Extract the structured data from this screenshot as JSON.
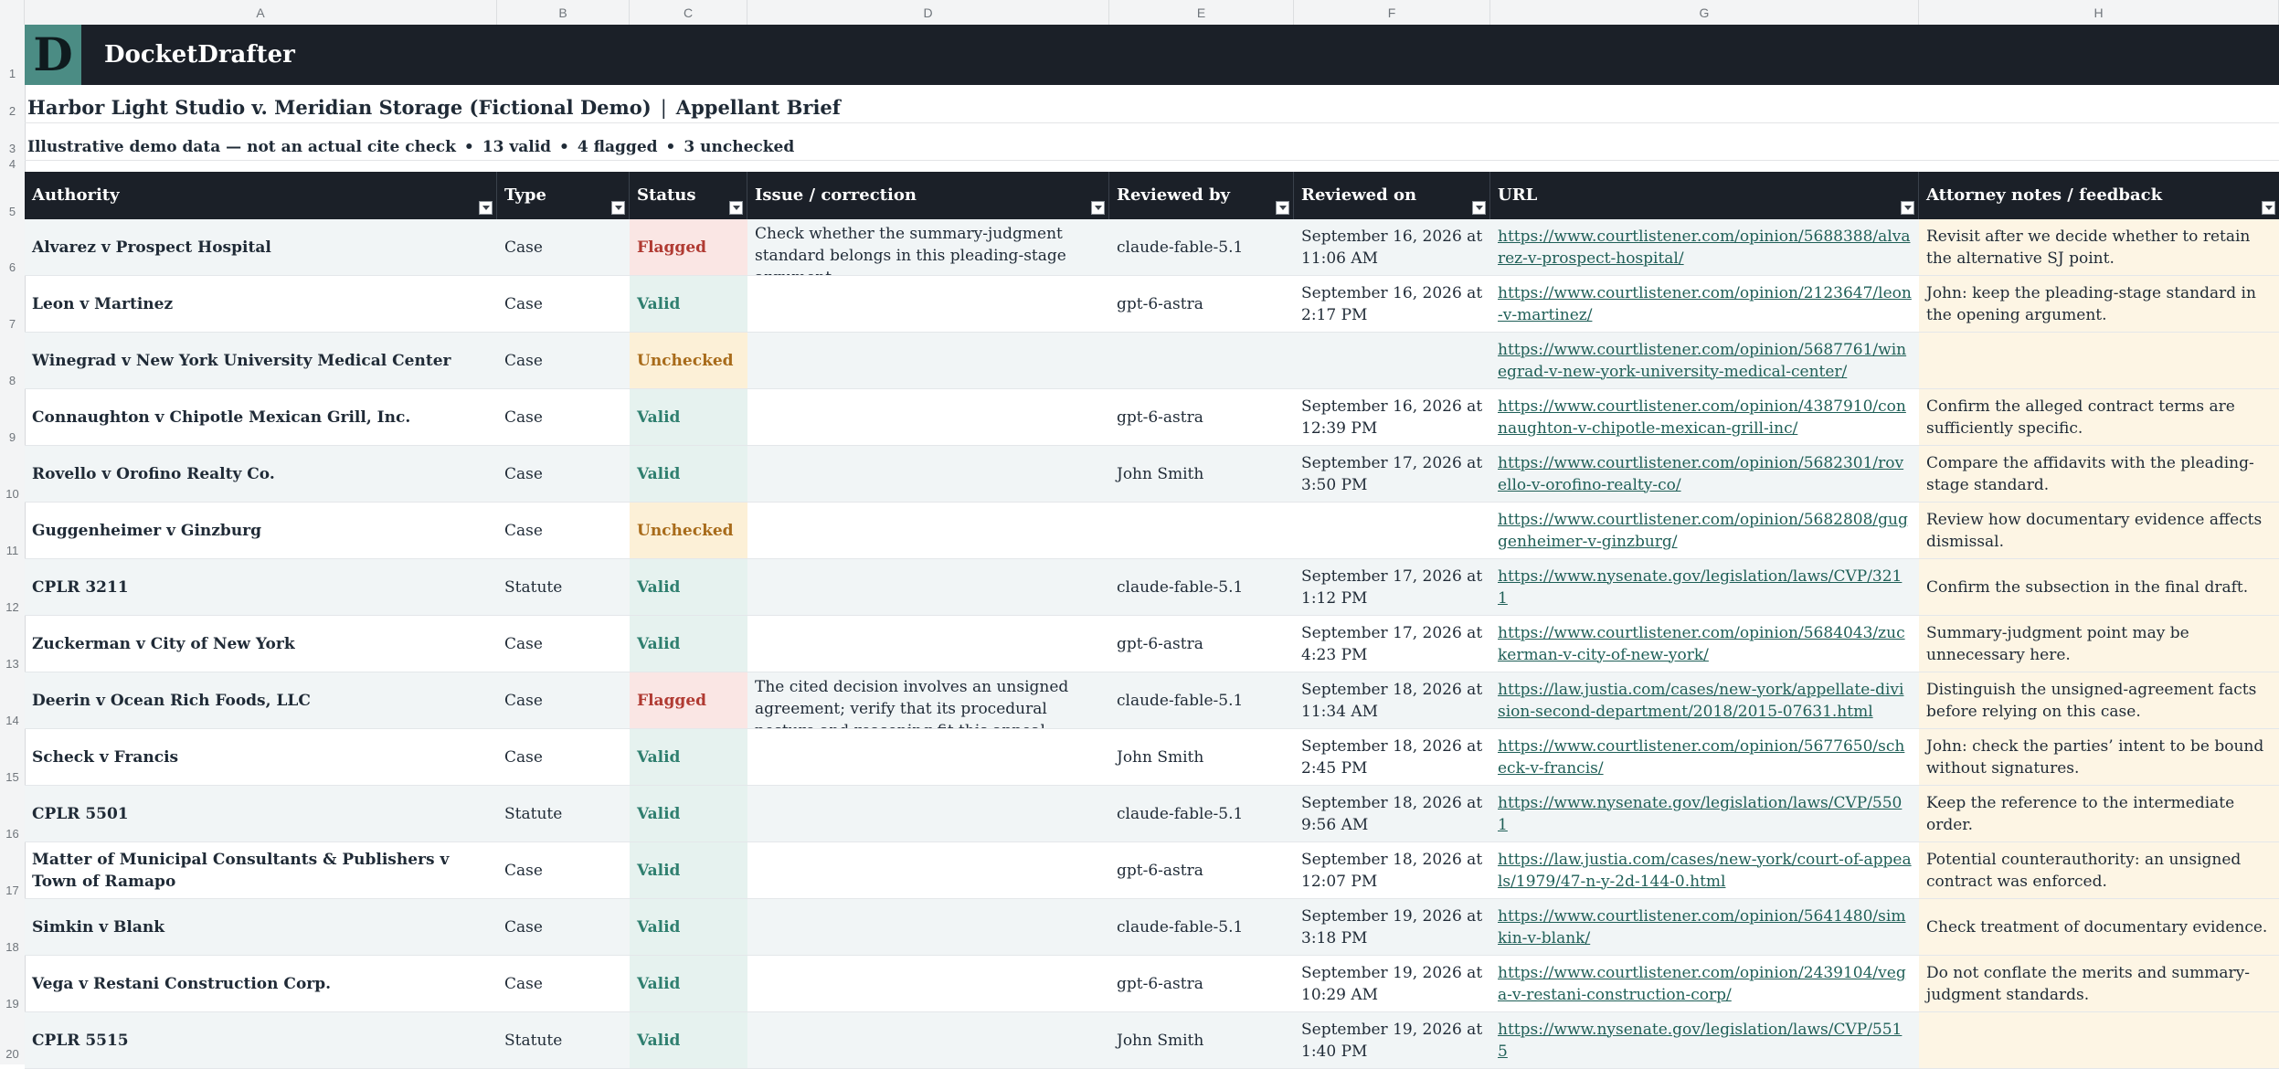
{
  "columns_letters": [
    "A",
    "B",
    "C",
    "D",
    "E",
    "F",
    "G",
    "H"
  ],
  "brand": {
    "logo_letter": "D",
    "name": "DocketDrafter"
  },
  "title": {
    "case": "Harbor Light Studio v. Meridian Storage (Fictional Demo)",
    "separator": "|",
    "document": "Appellant Brief"
  },
  "subtitle": {
    "note": "Illustrative demo data — not an actual cite check",
    "valid": "13 valid",
    "flagged": "4 flagged",
    "unchecked": "3 unchecked",
    "dot": "•"
  },
  "table": {
    "headers": [
      "Authority",
      "Type",
      "Status",
      "Issue / correction",
      "Reviewed by",
      "Reviewed on",
      "URL",
      "Attorney notes / feedback"
    ],
    "rows": [
      {
        "authority": "Alvarez v Prospect Hospital",
        "type": "Case",
        "status": "Flagged",
        "status_class": "flagged",
        "issue": "Check whether the summary-judgment standard belongs in this pleading-stage argument.",
        "reviewer": "claude-fable-5.1",
        "date": "September 16, 2026 at 11:06 AM",
        "url": "https://www.courtlistener.com/opinion/5688388/alvarez-v-prospect-hospital/",
        "notes": "Revisit after we decide whether to retain the alternative SJ point."
      },
      {
        "authority": "Leon v Martinez",
        "type": "Case",
        "status": "Valid",
        "status_class": "valid",
        "issue": "",
        "reviewer": "gpt-6-astra",
        "date": "September 16, 2026 at 2:17 PM",
        "url": "https://www.courtlistener.com/opinion/2123647/leon-v-martinez/",
        "notes": "John: keep the pleading-stage standard in the opening argument."
      },
      {
        "authority": "Winegrad v New York University Medical Center",
        "type": "Case",
        "status": "Unchecked",
        "status_class": "unchecked",
        "issue": "",
        "reviewer": "",
        "date": "",
        "url": "https://www.courtlistener.com/opinion/5687761/winegrad-v-new-york-university-medical-center/",
        "notes": ""
      },
      {
        "authority": "Connaughton v Chipotle Mexican Grill, Inc.",
        "type": "Case",
        "status": "Valid",
        "status_class": "valid",
        "issue": "",
        "reviewer": "gpt-6-astra",
        "date": "September 16, 2026 at 12:39 PM",
        "url": "https://www.courtlistener.com/opinion/4387910/connaughton-v-chipotle-mexican-grill-inc/",
        "notes": "Confirm the alleged contract terms are sufficiently specific."
      },
      {
        "authority": "Rovello v Orofino Realty Co.",
        "type": "Case",
        "status": "Valid",
        "status_class": "valid",
        "issue": "",
        "reviewer": "John Smith",
        "date": "September 17, 2026 at 3:50 PM",
        "url": "https://www.courtlistener.com/opinion/5682301/rovello-v-orofino-realty-co/",
        "notes": "Compare the affidavits with the pleading-stage standard."
      },
      {
        "authority": "Guggenheimer v Ginzburg",
        "type": "Case",
        "status": "Unchecked",
        "status_class": "unchecked",
        "issue": "",
        "reviewer": "",
        "date": "",
        "url": "https://www.courtlistener.com/opinion/5682808/guggenheimer-v-ginzburg/",
        "notes": "Review how documentary evidence affects dismissal."
      },
      {
        "authority": "CPLR 3211",
        "type": "Statute",
        "status": "Valid",
        "status_class": "valid",
        "issue": "",
        "reviewer": "claude-fable-5.1",
        "date": "September 17, 2026 at 1:12 PM",
        "url": "https://www.nysenate.gov/legislation/laws/CVP/3211",
        "notes": "Confirm the subsection in the final draft."
      },
      {
        "authority": "Zuckerman v City of New York",
        "type": "Case",
        "status": "Valid",
        "status_class": "valid",
        "issue": "",
        "reviewer": "gpt-6-astra",
        "date": "September 17, 2026 at 4:23 PM",
        "url": "https://www.courtlistener.com/opinion/5684043/zuckerman-v-city-of-new-york/",
        "notes": "Summary-judgment point may be unnecessary here."
      },
      {
        "authority": "Deerin v Ocean Rich Foods, LLC",
        "type": "Case",
        "status": "Flagged",
        "status_class": "flagged",
        "issue": "The cited decision involves an unsigned agreement; verify that its procedural posture and reasoning fit this appeal.",
        "reviewer": "claude-fable-5.1",
        "date": "September 18, 2026 at 11:34 AM",
        "url": "https://law.justia.com/cases/new-york/appellate-division-second-department/2018/2015-07631.html",
        "notes": "Distinguish the unsigned-agreement facts before relying on this case."
      },
      {
        "authority": "Scheck v Francis",
        "type": "Case",
        "status": "Valid",
        "status_class": "valid",
        "issue": "",
        "reviewer": "John Smith",
        "date": "September 18, 2026 at 2:45 PM",
        "url": "https://www.courtlistener.com/opinion/5677650/scheck-v-francis/",
        "notes": "John: check the parties’ intent to be bound without signatures."
      },
      {
        "authority": "CPLR 5501",
        "type": "Statute",
        "status": "Valid",
        "status_class": "valid",
        "issue": "",
        "reviewer": "claude-fable-5.1",
        "date": "September 18, 2026 at 9:56 AM",
        "url": "https://www.nysenate.gov/legislation/laws/CVP/5501",
        "notes": "Keep the reference to the intermediate order."
      },
      {
        "authority": "Matter of Municipal Consultants & Publishers v Town of Ramapo",
        "type": "Case",
        "status": "Valid",
        "status_class": "valid",
        "issue": "",
        "reviewer": "gpt-6-astra",
        "date": "September 18, 2026 at 12:07 PM",
        "url": "https://law.justia.com/cases/new-york/court-of-appeals/1979/47-n-y-2d-144-0.html",
        "notes": "Potential counterauthority: an unsigned contract was enforced."
      },
      {
        "authority": "Simkin v Blank",
        "type": "Case",
        "status": "Valid",
        "status_class": "valid",
        "issue": "",
        "reviewer": "claude-fable-5.1",
        "date": "September 19, 2026 at 3:18 PM",
        "url": "https://www.courtlistener.com/opinion/5641480/simkin-v-blank/",
        "notes": "Check treatment of documentary evidence."
      },
      {
        "authority": "Vega v Restani Construction Corp.",
        "type": "Case",
        "status": "Valid",
        "status_class": "valid",
        "issue": "",
        "reviewer": "gpt-6-astra",
        "date": "September 19, 2026 at 10:29 AM",
        "url": "https://www.courtlistener.com/opinion/2439104/vega-v-restani-construction-corp/",
        "notes": "Do not conflate the merits and summary-judgment standards."
      },
      {
        "authority": "CPLR 5515",
        "type": "Statute",
        "status": "Valid",
        "status_class": "valid",
        "issue": "",
        "reviewer": "John Smith",
        "date": "September 19, 2026 at 1:40 PM",
        "url": "https://www.nysenate.gov/legislation/laws/CVP/5515",
        "notes": ""
      }
    ]
  },
  "row_numbers": [
    "1",
    "2",
    "3",
    "4",
    "5",
    "6",
    "7",
    "8",
    "9",
    "10",
    "11",
    "12",
    "13",
    "14",
    "15",
    "16",
    "17",
    "18",
    "19",
    "20"
  ],
  "colors": {
    "header_bg": "#1b2028",
    "logo_bg": "#4b8c84",
    "valid": "#2f7f6f",
    "flagged": "#b03a32",
    "unchecked": "#a86b1a",
    "notes_bg": "#fdf5e4"
  }
}
